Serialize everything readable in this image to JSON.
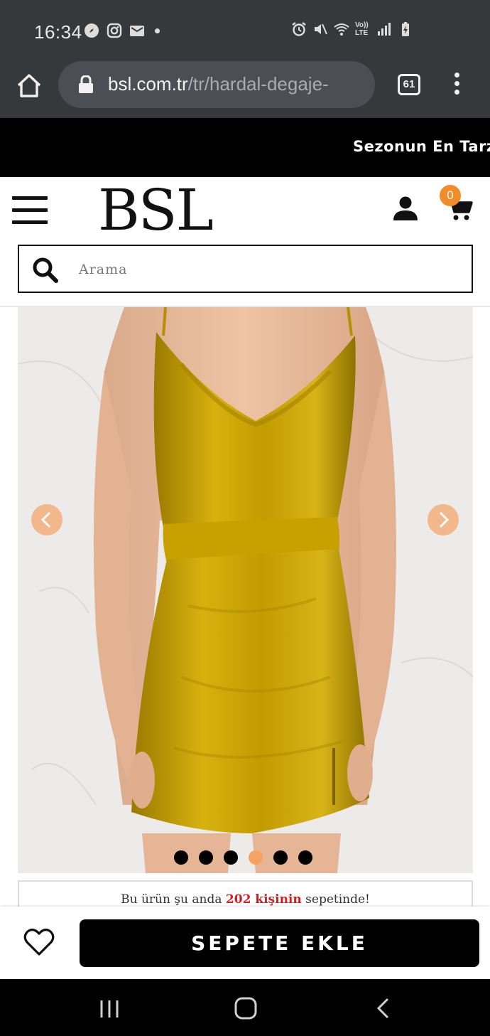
{
  "status_bar": {
    "time": "16:34",
    "left_icons": [
      "compass-icon",
      "instagram-icon",
      "mail-icon",
      "dot-indicator"
    ],
    "right_icons": [
      "alarm-icon",
      "mute-icon",
      "wifi-icon",
      "volte-icon",
      "signal-icon",
      "battery-icon"
    ],
    "volte_label": "Vo)) LTE"
  },
  "browser": {
    "url_domain": "bsl.com.tr",
    "url_path": "/tr/hardal-degaje-",
    "tab_count": "61"
  },
  "promo": {
    "text": "Sezonun En Tarz"
  },
  "header": {
    "logo": "BSL",
    "cart_count": "0"
  },
  "search": {
    "placeholder": "Arama"
  },
  "product": {
    "image_alt": "",
    "slide_count": 6,
    "active_slide": 4
  },
  "notice": {
    "prefix": "Bu ürün şu anda",
    "count": "202 kişinin",
    "suffix": "sepetinde!"
  },
  "actions": {
    "add_to_cart": "SEPETE EKLE"
  },
  "colors": {
    "accent": "#f28c28",
    "dot_active": "#f4a460",
    "notice_highlight": "#d21e1e",
    "dress": "#c8a000"
  }
}
